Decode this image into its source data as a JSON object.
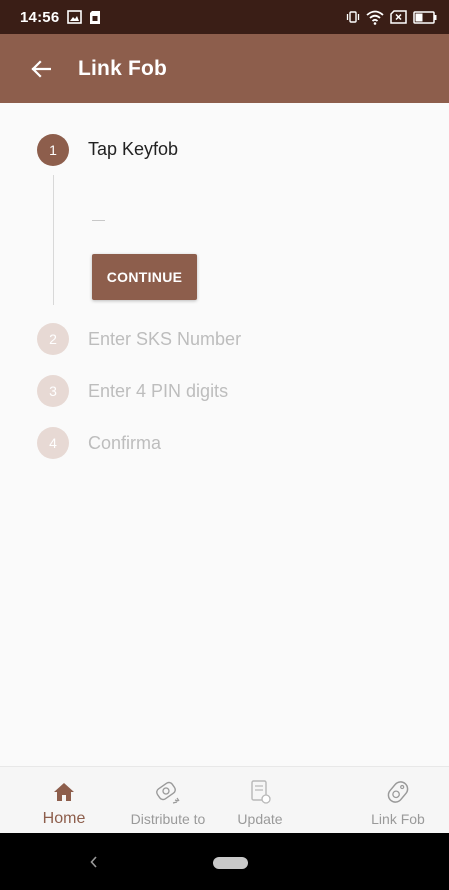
{
  "status_bar": {
    "time": "14:56"
  },
  "app_bar": {
    "title": "Link Fob"
  },
  "stepper": {
    "steps": [
      {
        "number": "1",
        "label": "Tap Keyfob",
        "state": "active"
      },
      {
        "number": "2",
        "label": "Enter SKS Number",
        "state": "inactive"
      },
      {
        "number": "3",
        "label": "Enter 4 PIN digits",
        "state": "inactive"
      },
      {
        "number": "4",
        "label": "Confirma",
        "state": "inactive"
      }
    ],
    "continue_label": "CONTINUE"
  },
  "bottom_nav": {
    "items": [
      {
        "label": "Home",
        "icon": "home-icon",
        "active": true
      },
      {
        "label": "Distribute to",
        "icon": "keyfob-distribute-icon",
        "active": false
      },
      {
        "label": "Update",
        "icon": "update-icon",
        "active": false
      },
      {
        "label": "Link Fob",
        "icon": "link-fob-icon",
        "active": false
      }
    ]
  },
  "colors": {
    "status_bar": "#3a1e16",
    "primary": "#8d5e4c",
    "inactive_circle": "#e7d9d4",
    "inactive_text": "#bdbdbd",
    "nav_inactive": "#9a9a9a"
  }
}
